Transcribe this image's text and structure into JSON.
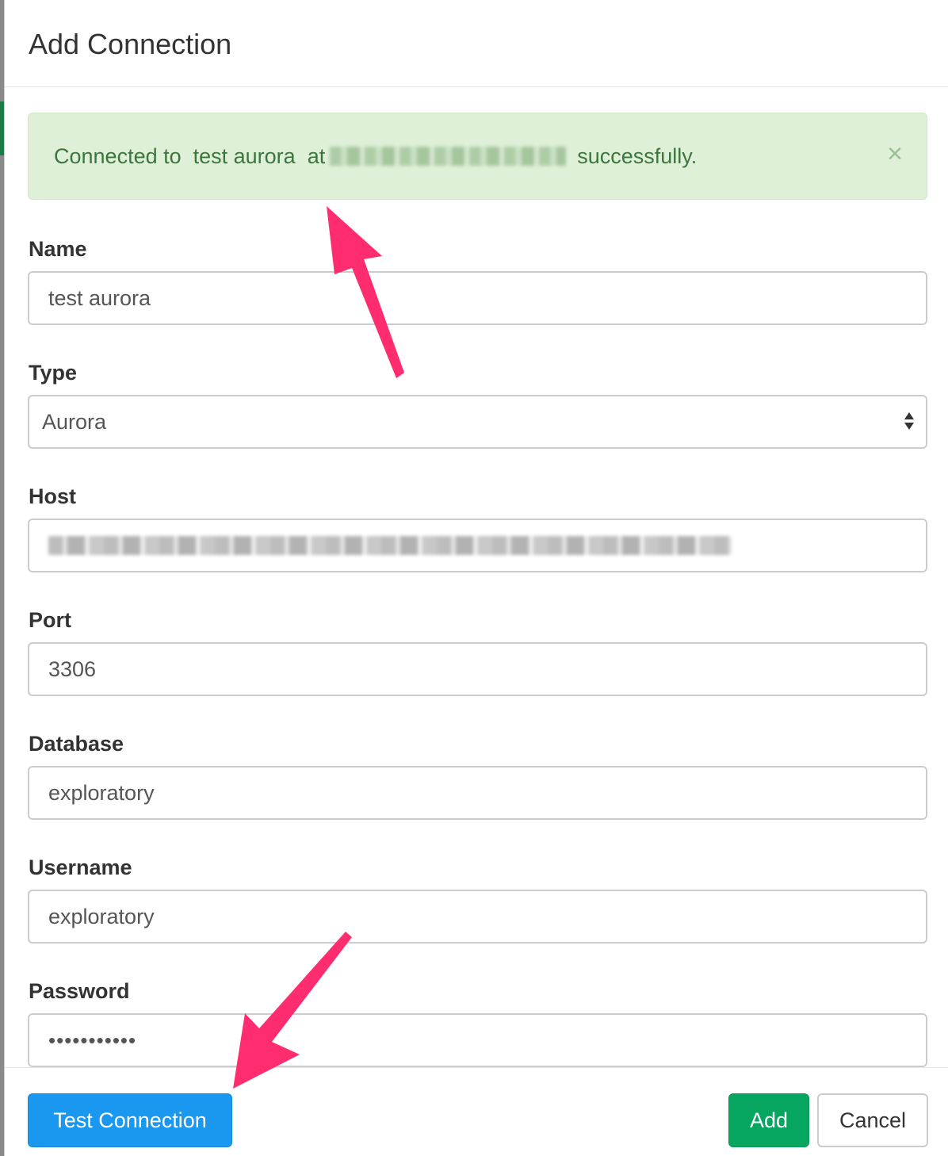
{
  "dialog": {
    "title": "Add Connection"
  },
  "alert": {
    "message_prefix": "Connected to  test aurora  at",
    "message_suffix": "successfully.",
    "close_glyph": "×",
    "color": "#3c763d",
    "background": "#dff0d8"
  },
  "form": {
    "name": {
      "label": "Name",
      "value": "test aurora"
    },
    "type": {
      "label": "Type",
      "value": "Aurora"
    },
    "host": {
      "label": "Host",
      "value_obscured": true
    },
    "port": {
      "label": "Port",
      "value": "3306"
    },
    "database": {
      "label": "Database",
      "value": "exploratory"
    },
    "username": {
      "label": "Username",
      "value": "exploratory"
    },
    "password": {
      "label": "Password",
      "value": "•••••••••••"
    }
  },
  "footer": {
    "test_button": "Test Connection",
    "add_button": "Add",
    "cancel_button": "Cancel"
  },
  "colors": {
    "primary": "#1a98f0",
    "success": "#06a660",
    "annotation_arrow": "#ff2d6f"
  },
  "icons": {
    "close": "close-icon",
    "select": "select-arrows-icon",
    "annotation": "annotation-arrow"
  }
}
